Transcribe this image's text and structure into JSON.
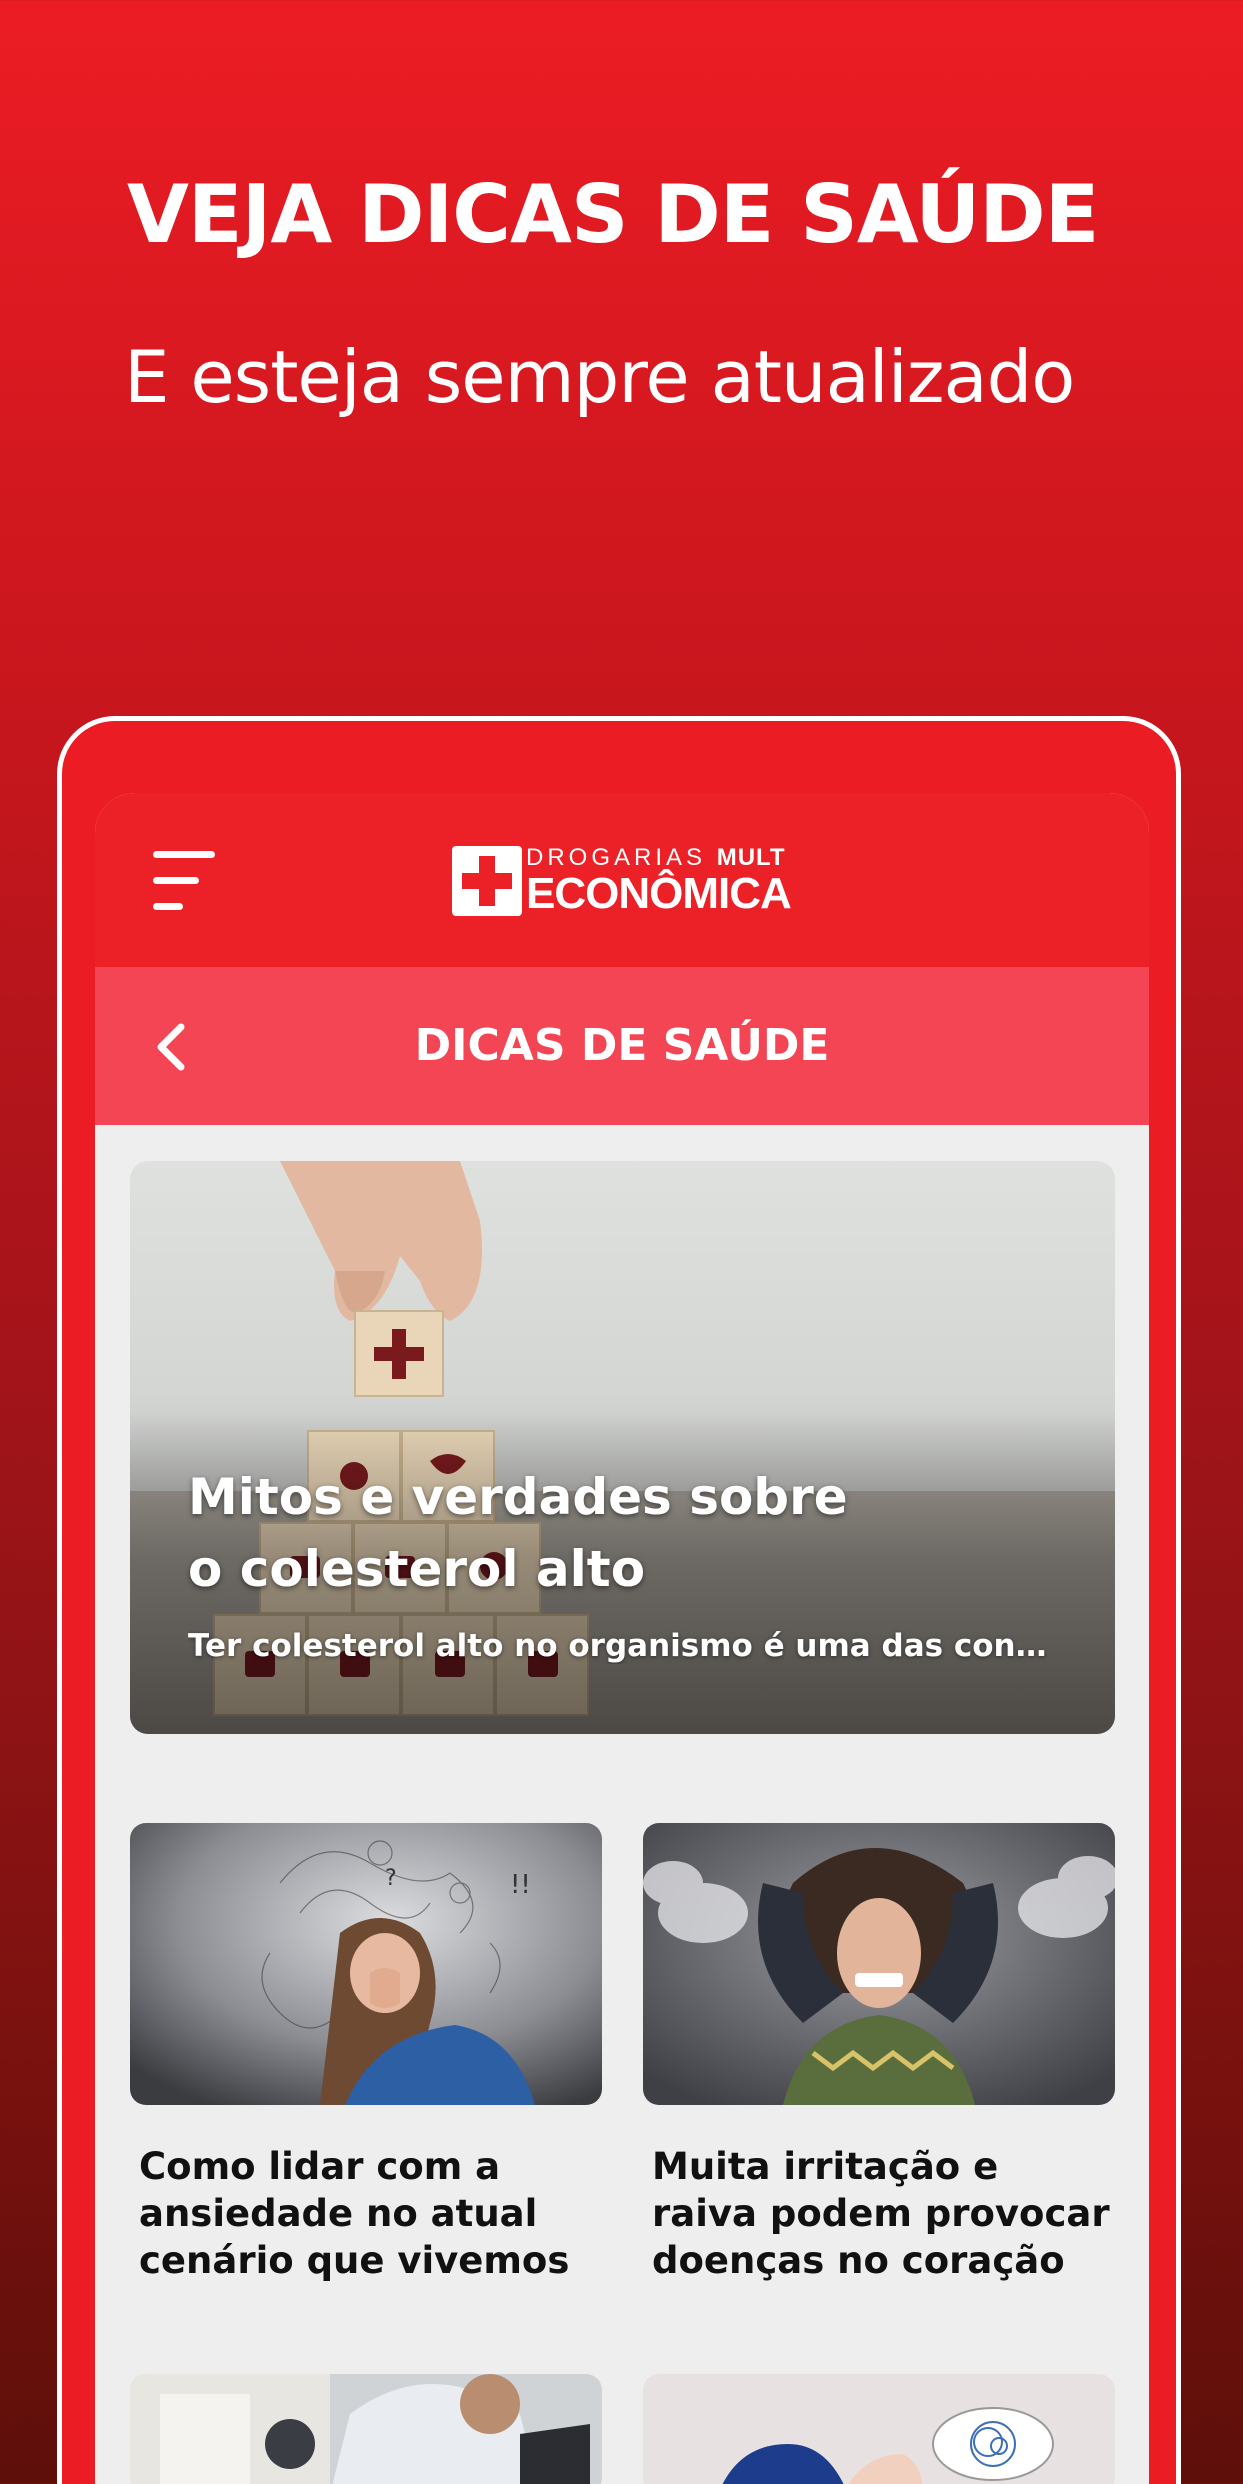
{
  "promo": {
    "title": "VEJA DICAS DE SAÚDE",
    "subtitle": "E esteja sempre atualizado"
  },
  "app": {
    "logo": {
      "top": "DROGARIAS",
      "top_bold": "MULT",
      "bottom": "ECONÔMICA"
    },
    "header_title": "DICAS DE SAÚDE",
    "colors": {
      "primary": "#ec2027",
      "secondary": "#f34553",
      "background": "#eeeeee"
    }
  },
  "featured": {
    "title": "Mitos e verdades sobre o colesterol alto",
    "description": "Ter colesterol alto no organismo é uma das condiç..."
  },
  "articles": [
    {
      "title": "Como lidar com a ansiedade no atual cenário que vivemos"
    },
    {
      "title": "Muita irritação e raiva podem provocar doenças no coração"
    },
    {
      "title": ""
    },
    {
      "title": ""
    }
  ]
}
